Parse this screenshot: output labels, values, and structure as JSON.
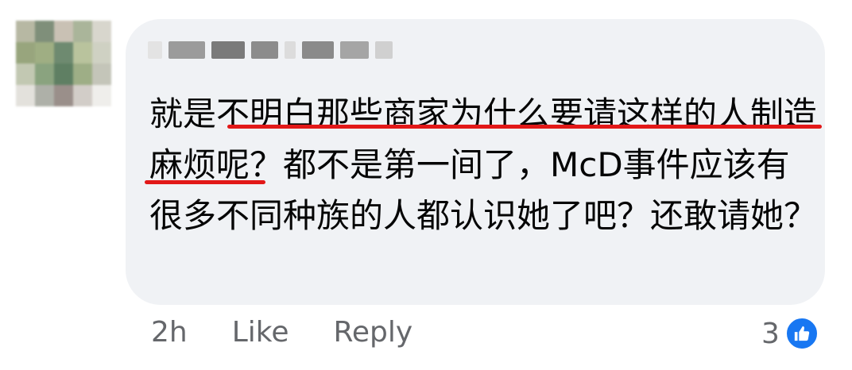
{
  "comment": {
    "author_name": "",
    "text": "就是不明白那些商家为什么要请这样的人制造麻烦呢？都不是第一间了，McD事件应该有很多不同种族的人都认识她了吧？还敢请她？"
  },
  "actions": {
    "time": "2h",
    "like": "Like",
    "reply": "Reply"
  },
  "reactions": {
    "count": "3",
    "icon": "like-reaction-icon",
    "color": "#1877f2"
  },
  "annotation_color": "#e21818"
}
